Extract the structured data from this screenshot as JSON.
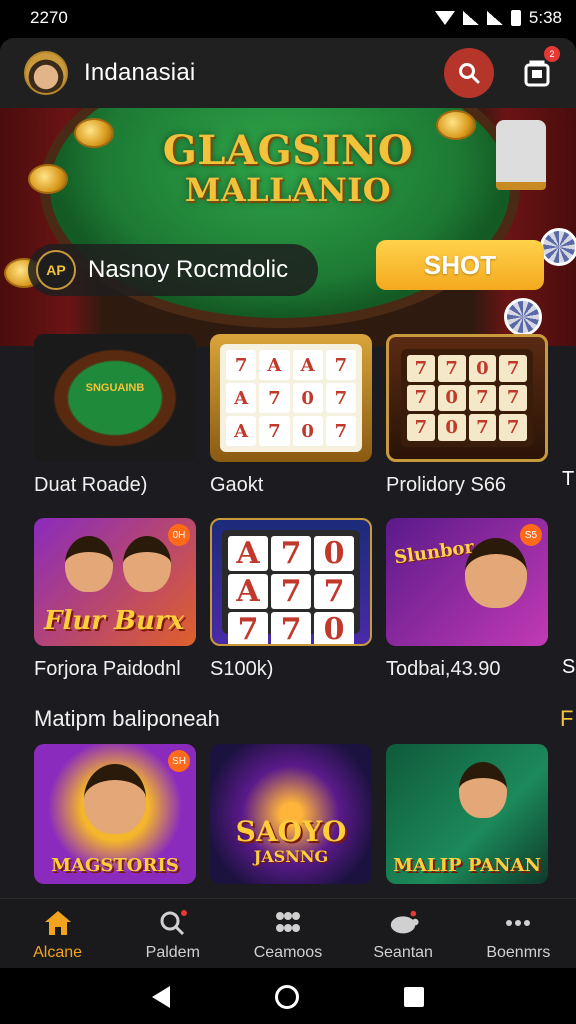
{
  "status_bar": {
    "time": "2270",
    "clock": "5:38"
  },
  "header": {
    "app_name": "Indanasiai",
    "notification_count": "2"
  },
  "hero": {
    "title_line1": "GLAGSINO",
    "title_line2": "MALLANIO",
    "pill_logo": "AP",
    "pill_text": "Nasnoy Rocmdolic",
    "cta_label": "SHOT"
  },
  "row1": [
    {
      "caption": "Duat Roade)",
      "felt_text": "SNGUAINB"
    },
    {
      "caption": "Gaokt",
      "reels": [
        "7",
        "A",
        "A",
        "7",
        "A",
        "7",
        "0",
        "7",
        "A",
        "7",
        "0",
        "7"
      ]
    },
    {
      "caption": "Prolidory S66",
      "reels": [
        "7",
        "7",
        "0",
        "7",
        "7",
        "0",
        "7",
        "7",
        "7",
        "0",
        "7",
        "7"
      ]
    }
  ],
  "row1_peek": "T",
  "row2": [
    {
      "caption": "Forjora Paidodnl",
      "badge": "0H",
      "label": "Flur Burx"
    },
    {
      "caption": "S100k)",
      "reels": [
        "A",
        "7",
        "0",
        "A",
        "7",
        "7",
        "7",
        "7",
        "0"
      ]
    },
    {
      "caption": "Todbai,43.90",
      "badge": "S5",
      "label": "Slunbor"
    }
  ],
  "row2_peek": "S",
  "section": {
    "title": "Matipm baliponeah",
    "peek": "F"
  },
  "row3": [
    {
      "badge": "SH",
      "label": "MAGSTORIS"
    },
    {
      "label": "SAOYO",
      "label2": "JASNNG"
    },
    {
      "label": "MALIP PANAN"
    }
  ],
  "bottom_nav": [
    {
      "label": "Alcane",
      "icon": "home-icon",
      "active": true
    },
    {
      "label": "Paldem",
      "icon": "search-badge-icon",
      "active": false
    },
    {
      "label": "Ceamoos",
      "icon": "grid-icon",
      "active": false
    },
    {
      "label": "Seantan",
      "icon": "turtle-icon",
      "active": false
    },
    {
      "label": "Boenmrs",
      "icon": "more-icon",
      "active": false
    }
  ],
  "colors": {
    "accent": "#f2a41f",
    "search_button": "#b5352b",
    "cta": "#ffd24a",
    "background": "#1c1b1f"
  }
}
